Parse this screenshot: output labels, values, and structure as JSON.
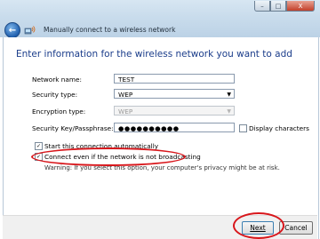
{
  "window": {
    "title": "Manually connect to a wireless network",
    "controls": {
      "minimize": "–",
      "maximize": "□",
      "close": "X"
    }
  },
  "main": {
    "heading": "Enter information for the wireless network you want to add",
    "network_name": {
      "label": "Network name:",
      "value": "TEST"
    },
    "security_type": {
      "label": "Security type:",
      "value": "WEP"
    },
    "encryption_type": {
      "label": "Encryption type:",
      "value": "WEP"
    },
    "security_key": {
      "label": "Security Key/Passphrase:",
      "value": "●●●●●●●●●●"
    },
    "display_characters": {
      "label": "Display characters",
      "checked": false
    },
    "start_automatically": {
      "label": "Start this connection automatically",
      "checked": true
    },
    "connect_even_if_not_broadcasting": {
      "label": "Connect even if the network is not broadcasting",
      "checked": true
    },
    "warning": "Warning: If you select this option, your computer's privacy might be at risk."
  },
  "footer": {
    "next_label": "Next",
    "cancel_label": "Cancel"
  },
  "colors": {
    "heading": "#1a3c8a",
    "annotation_red": "#d8161b"
  }
}
